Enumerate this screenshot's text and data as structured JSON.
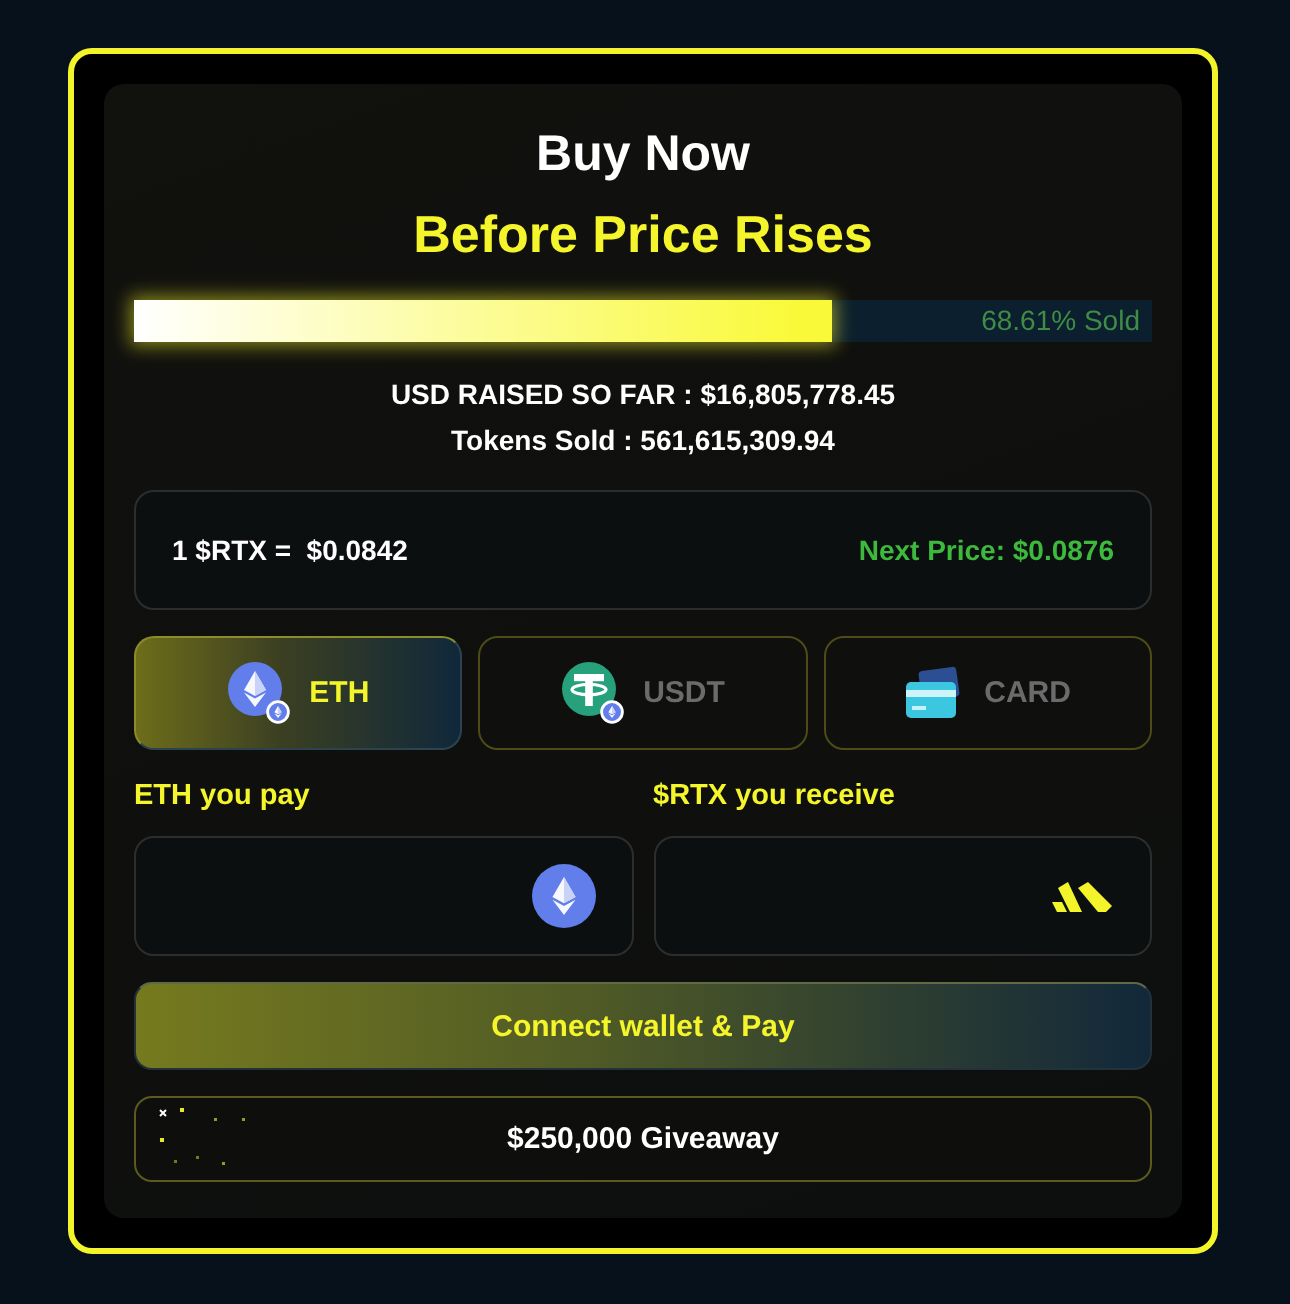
{
  "header": {
    "title": "Buy Now",
    "subtitle": "Before Price Rises"
  },
  "progress": {
    "level": 0.6861,
    "label": "68.61% Sold"
  },
  "stats": [
    "USD RAISED SO FAR : $16,805,778.45",
    "Tokens Sold : 561,615,309.94"
  ],
  "price": {
    "current": "1 $RTX =  $0.0842",
    "next": "Next Price: $0.0876"
  },
  "payment_tabs": [
    {
      "kind": "eth",
      "label": "ETH",
      "selected": true
    },
    {
      "kind": "usdt",
      "label": "USDT",
      "selected": false
    },
    {
      "kind": "card",
      "label": "CARD",
      "selected": false
    }
  ],
  "fields": [
    {
      "kind": "eth",
      "label": "ETH you pay"
    },
    {
      "kind": "rtx",
      "label": "$RTX you receive"
    }
  ],
  "pay_button": "Connect wallet & Pay",
  "giveaway_button": "$250,000 Giveaway"
}
